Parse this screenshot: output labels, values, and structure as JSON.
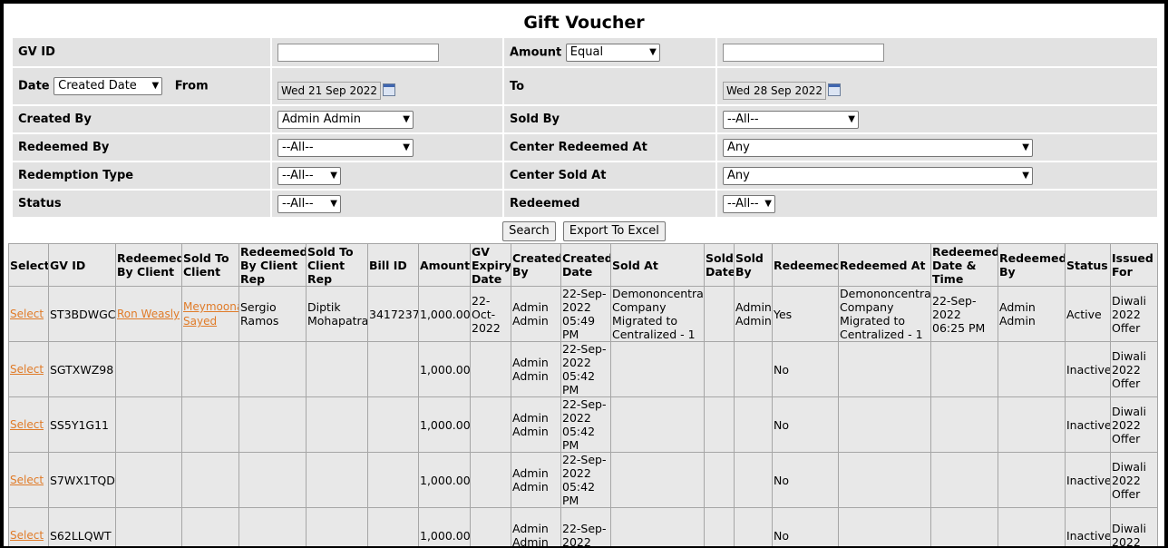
{
  "page_title": "Gift Voucher",
  "filters": {
    "gv_id_label": "GV ID",
    "gv_id_value": "",
    "amount_label": "Amount",
    "amount_operator": "Equal",
    "amount_value": "",
    "date_label": "Date",
    "date_type": "Created Date",
    "from_label": "From",
    "from_date": "Wed 21 Sep 2022",
    "to_label": "To",
    "to_date": "Wed 28 Sep 2022",
    "created_by_label": "Created By",
    "created_by_value": "Admin Admin",
    "sold_by_label": "Sold By",
    "sold_by_value": "--All--",
    "redeemed_by_label": "Redeemed By",
    "redeemed_by_value": "--All--",
    "center_redeemed_label": "Center Redeemed At",
    "center_redeemed_value": "Any",
    "redemption_type_label": "Redemption Type",
    "redemption_type_value": "--All--",
    "center_sold_label": "Center Sold At",
    "center_sold_value": "Any",
    "status_label": "Status",
    "status_value": "--All--",
    "redeemed_label": "Redeemed",
    "redeemed_value": "--All--"
  },
  "actions": {
    "search": "Search",
    "export": "Export To Excel"
  },
  "table": {
    "headers": {
      "select": "Select",
      "gv_id": "GV ID",
      "redeemed_by_client": "Redeemed By Client",
      "sold_to_client": "Sold To Client",
      "redeemed_by_client_rep": "Redeemed By Client Rep",
      "sold_to_client_rep": "Sold To Client Rep",
      "bill_id": "Bill ID",
      "amount": "Amount",
      "gv_expiry_date": "GV Expiry Date",
      "created_by": "Created By",
      "created_date": "Created Date",
      "sold_at": "Sold At",
      "sold_date": "Sold Date",
      "sold_by": "Sold By",
      "redeemed": "Redeemed",
      "redeemed_at": "Redeemed At",
      "redeemed_datetime": "Redeemed Date & Time",
      "redeemed_by": "Redeemed By",
      "status": "Status",
      "issued_for": "Issued For"
    },
    "rows": [
      {
        "select": "Select",
        "gv_id": "ST3BDWGC",
        "redeemed_by_client": "Ron Weasly",
        "sold_to_client": "Meymoona Sayed",
        "redeemed_by_client_rep": "Sergio Ramos",
        "sold_to_client_rep": "Diptik Mohapatra",
        "bill_id": "3417237",
        "amount": "1,000.00",
        "gv_expiry_date": "22-Oct-2022",
        "created_by": "Admin Admin",
        "created_date": "22-Sep-2022 05:49 PM",
        "sold_at": "Demononcentral Company Migrated to Centralized - 1",
        "sold_date": "",
        "sold_by": "Admin Admin",
        "redeemed": "Yes",
        "redeemed_at": "Demononcentral Company Migrated to Centralized - 1",
        "redeemed_datetime": "22-Sep-2022 06:25 PM",
        "redeemed_by": "Admin Admin",
        "status": "Active",
        "issued_for": "Diwali 2022 Offer"
      },
      {
        "select": "Select",
        "gv_id": "SGTXWZ98",
        "redeemed_by_client": "",
        "sold_to_client": "",
        "redeemed_by_client_rep": "",
        "sold_to_client_rep": "",
        "bill_id": "",
        "amount": "1,000.00",
        "gv_expiry_date": "",
        "created_by": "Admin Admin",
        "created_date": "22-Sep-2022 05:42 PM",
        "sold_at": "",
        "sold_date": "",
        "sold_by": "",
        "redeemed": "No",
        "redeemed_at": "",
        "redeemed_datetime": "",
        "redeemed_by": "",
        "status": "Inactive",
        "issued_for": "Diwali 2022 Offer"
      },
      {
        "select": "Select",
        "gv_id": "SS5Y1G11",
        "redeemed_by_client": "",
        "sold_to_client": "",
        "redeemed_by_client_rep": "",
        "sold_to_client_rep": "",
        "bill_id": "",
        "amount": "1,000.00",
        "gv_expiry_date": "",
        "created_by": "Admin Admin",
        "created_date": "22-Sep-2022 05:42 PM",
        "sold_at": "",
        "sold_date": "",
        "sold_by": "",
        "redeemed": "No",
        "redeemed_at": "",
        "redeemed_datetime": "",
        "redeemed_by": "",
        "status": "Inactive",
        "issued_for": "Diwali 2022 Offer"
      },
      {
        "select": "Select",
        "gv_id": "S7WX1TQD",
        "redeemed_by_client": "",
        "sold_to_client": "",
        "redeemed_by_client_rep": "",
        "sold_to_client_rep": "",
        "bill_id": "",
        "amount": "1,000.00",
        "gv_expiry_date": "",
        "created_by": "Admin Admin",
        "created_date": "22-Sep-2022 05:42 PM",
        "sold_at": "",
        "sold_date": "",
        "sold_by": "",
        "redeemed": "No",
        "redeemed_at": "",
        "redeemed_datetime": "",
        "redeemed_by": "",
        "status": "Inactive",
        "issued_for": "Diwali 2022 Offer"
      },
      {
        "select": "Select",
        "gv_id": "S62LLQWT",
        "redeemed_by_client": "",
        "sold_to_client": "",
        "redeemed_by_client_rep": "",
        "sold_to_client_rep": "",
        "bill_id": "",
        "amount": "1,000.00",
        "gv_expiry_date": "",
        "created_by": "Admin Admin",
        "created_date": "22-Sep-2022",
        "sold_at": "",
        "sold_date": "",
        "sold_by": "",
        "redeemed": "No",
        "redeemed_at": "",
        "redeemed_datetime": "",
        "redeemed_by": "",
        "status": "Inactive",
        "issued_for": "Diwali 2022"
      }
    ]
  }
}
